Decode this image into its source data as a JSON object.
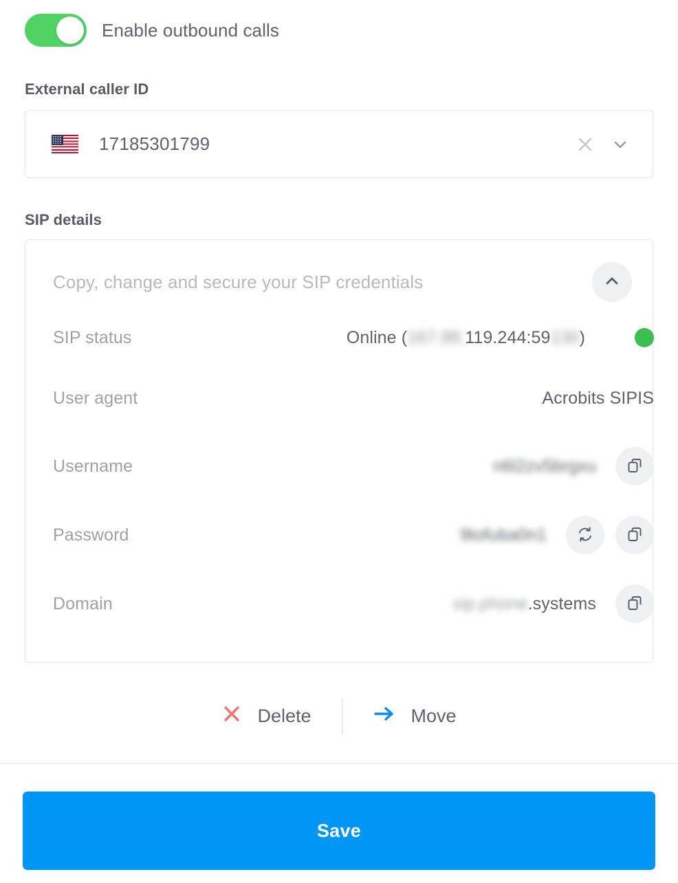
{
  "toggle": {
    "label": "Enable outbound calls",
    "enabled": true,
    "on_color": "#4ed364"
  },
  "caller_id": {
    "section_label": "External caller ID",
    "flag": "us-flag-icon",
    "value": "17185301799",
    "clear_icon": "close-icon",
    "dropdown_icon": "chevron-down-icon"
  },
  "sip": {
    "section_label": "SIP details",
    "card_header": "Copy, change and secure your SIP credentials",
    "collapse_icon": "chevron-up-icon",
    "rows": [
      {
        "label": "SIP status",
        "value_prefix": "Online (",
        "value_blurred_1": "167.99.",
        "value_clear": "119.244:59",
        "value_blurred_2": "130",
        "value_suffix": ")",
        "dot_color": "#3bbf52"
      },
      {
        "label": "User agent",
        "value": "Acrobits SIPIS"
      },
      {
        "label": "Username",
        "value_blurred": "n6l2zv5brgxu",
        "copy_icon": "copy-icon"
      },
      {
        "label": "Password",
        "value_blurred": "9tofuba0n1",
        "refresh_icon": "refresh-icon",
        "copy_icon": "copy-icon"
      },
      {
        "label": "Domain",
        "value_blurred": "sip.phone",
        "value_clear": ".systems",
        "copy_icon": "copy-icon"
      }
    ]
  },
  "actions": {
    "delete": {
      "label": "Delete",
      "icon": "close-x-icon",
      "color": "#f4726d"
    },
    "move": {
      "label": "Move",
      "icon": "arrow-right-icon",
      "color": "#0d8aee"
    }
  },
  "footer": {
    "save_label": "Save",
    "save_color": "#0096f5"
  }
}
